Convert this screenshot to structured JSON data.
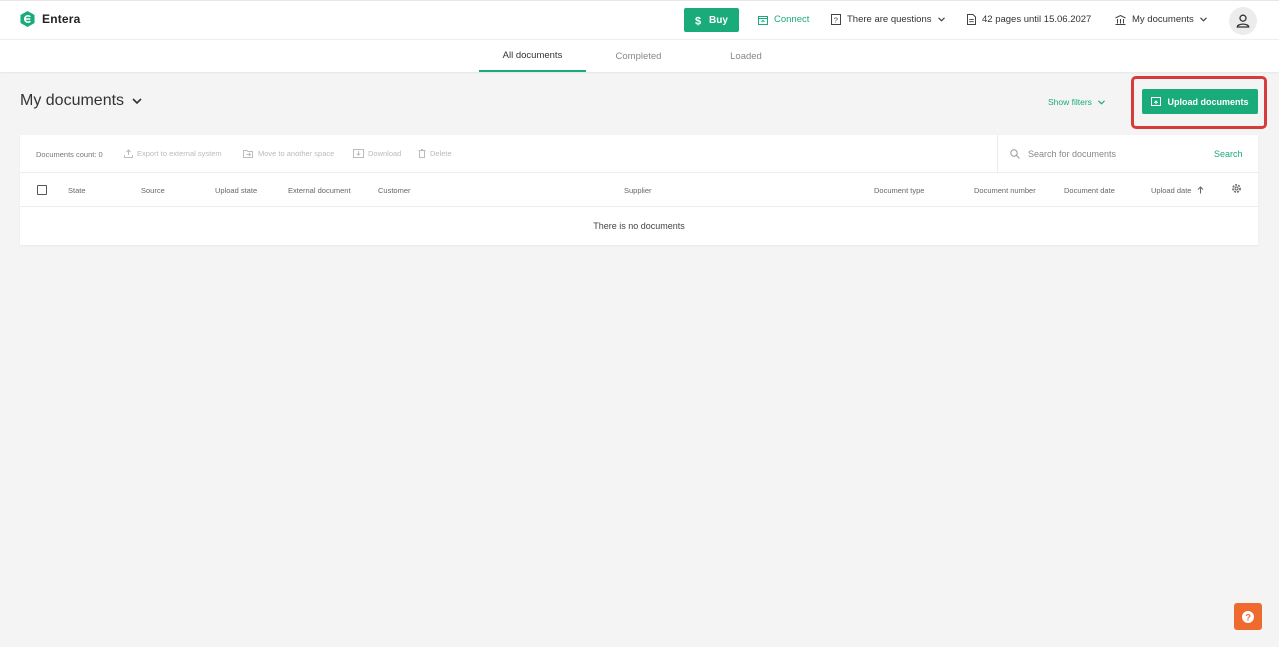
{
  "app": {
    "name": "Entera"
  },
  "header": {
    "buy_label": "Buy",
    "connect_label": "Connect",
    "questions_label": "There are questions",
    "pages_info": "42 pages until 15.06.2027",
    "docs_menu_label": "My documents"
  },
  "tabs": [
    {
      "label": "All documents",
      "active": true
    },
    {
      "label": "Completed",
      "active": false
    },
    {
      "label": "Loaded",
      "active": false
    }
  ],
  "page": {
    "title": "My documents",
    "show_filters_label": "Show filters",
    "upload_label": "Upload documents"
  },
  "toolbar": {
    "count_label": "Documents count: 0",
    "export_label": "Export to external system",
    "move_label": "Move to another space",
    "download_label": "Download",
    "delete_label": "Delete"
  },
  "search": {
    "placeholder": "Search for documents",
    "button_label": "Search"
  },
  "table": {
    "columns": [
      "State",
      "Source",
      "Upload state",
      "External document",
      "Customer",
      "Supplier",
      "Document type",
      "Document number",
      "Document date",
      "Upload date"
    ],
    "empty_message": "There is no documents"
  },
  "colors": {
    "accent": "#1aab7b",
    "highlight": "#d63c3c",
    "help": "#ef6a2e"
  }
}
